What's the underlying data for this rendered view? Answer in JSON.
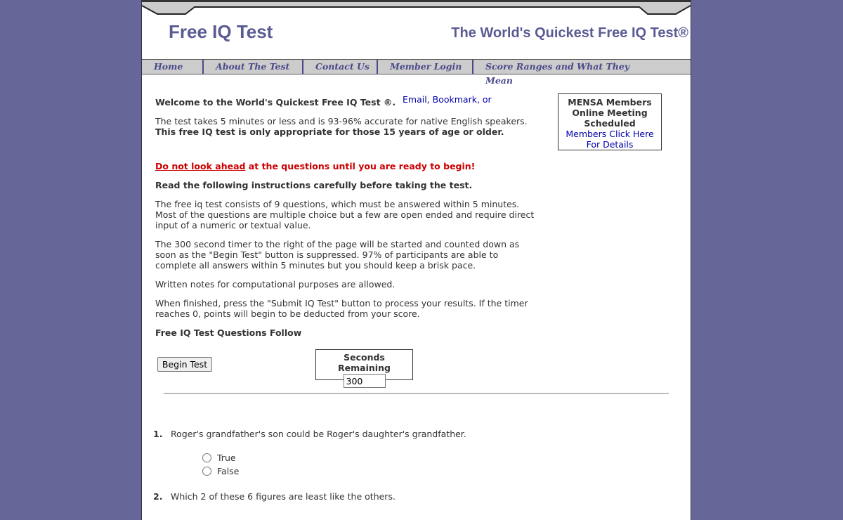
{
  "header": {
    "site_title": "Free IQ Test",
    "tagline": "The World's Quickest Free IQ Test®"
  },
  "nav": {
    "items": [
      "Home",
      "About The Test",
      "Contact Us",
      "Member Login",
      "Score Ranges and What They Mean"
    ]
  },
  "intro": {
    "welcome": "Welcome to the World's Quickest Free IQ Test ®.",
    "share_links": "Email, Bookmark, or",
    "duration_text": "The test takes 5 minutes or less and is 93-96% accurate for native English speakers.",
    "age_note": "This free IQ test is only appropriate for those 15 years of age or older.",
    "warning_link": "Do not look ahead",
    "warning_rest": " at the questions until you are ready to begin!",
    "read_instructions": "Read the following instructions carefully before taking the test.",
    "para1": "The free iq test consists of 9 questions, which must be answered within 5 minutes. Most of the questions are multiple choice but a few are open ended and require direct input of a numeric or textual value.",
    "para2": "The 300 second timer to the right of the page will be started and counted down as soon as the \"Begin Test\" button is suppressed. 97% of participants are able to complete all answers within 5 minutes but you should keep a brisk pace.",
    "para3": "Written notes for computational purposes are allowed.",
    "para4": "When finished, press the \"Submit IQ Test\" button to process your results. If the timer reaches 0, points will begin to be deducted from your score.",
    "follow": "Free IQ Test Questions Follow"
  },
  "mensa": {
    "line1": "MENSA Members",
    "line2": "Online Meeting",
    "line3": "Scheduled",
    "link1": "Members Click Here",
    "link2": "For Details"
  },
  "controls": {
    "begin_label": "Begin Test",
    "timer_label": "Seconds Remaining",
    "timer_value": "300"
  },
  "questions": [
    {
      "number": "1.",
      "text": "Roger's grandfather's son could be Roger's daughter's grandfather.",
      "options": [
        "True",
        "False"
      ]
    },
    {
      "number": "2.",
      "text": "Which 2 of these 6 figures are least like the others."
    }
  ],
  "colors": {
    "background": "#666699",
    "title": "#5b5b94",
    "nav_bar": "#cccccc",
    "warning": "#cc0000",
    "link": "#0000aa"
  }
}
